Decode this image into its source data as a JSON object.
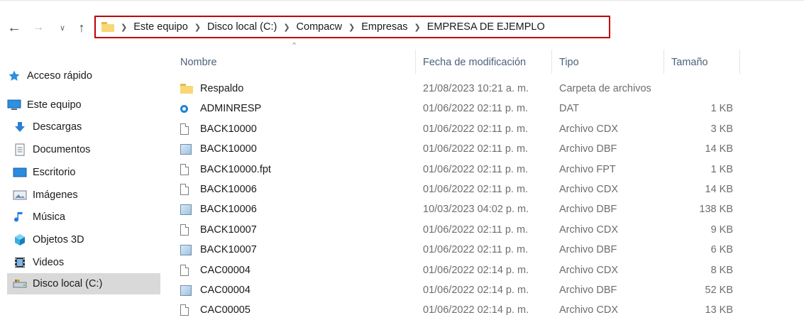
{
  "address": {
    "crumbs": [
      "Este equipo",
      "Disco local (C:)",
      "Compacw",
      "Empresas",
      "EMPRESA DE EJEMPLO"
    ]
  },
  "columns": {
    "name": "Nombre",
    "date": "Fecha de modificación",
    "type": "Tipo",
    "size": "Tamaño"
  },
  "sidebar": {
    "items": [
      {
        "label": "Acceso rápido",
        "icon": "star-icon"
      },
      {
        "label": "Este equipo",
        "icon": "computer-icon"
      },
      {
        "label": "Descargas",
        "icon": "download-icon"
      },
      {
        "label": "Documentos",
        "icon": "documents-icon"
      },
      {
        "label": "Escritorio",
        "icon": "desktop-icon"
      },
      {
        "label": "Imágenes",
        "icon": "pictures-icon"
      },
      {
        "label": "Música",
        "icon": "music-icon"
      },
      {
        "label": "Objetos 3D",
        "icon": "objects3d-icon"
      },
      {
        "label": "Videos",
        "icon": "videos-icon"
      },
      {
        "label": "Disco local (C:)",
        "icon": "drive-icon"
      }
    ]
  },
  "files": [
    {
      "name": "Respaldo",
      "date": "21/08/2023 10:21 a. m.",
      "type": "Carpeta de archivos",
      "size": "",
      "icon": "folder"
    },
    {
      "name": "ADMINRESP",
      "date": "01/06/2022 02:11 p. m.",
      "type": "DAT",
      "size": "1 KB",
      "icon": "dat"
    },
    {
      "name": "BACK10000",
      "date": "01/06/2022 02:11 p. m.",
      "type": "Archivo CDX",
      "size": "3 KB",
      "icon": "doc"
    },
    {
      "name": "BACK10000",
      "date": "01/06/2022 02:11 p. m.",
      "type": "Archivo DBF",
      "size": "14 KB",
      "icon": "dbf"
    },
    {
      "name": "BACK10000.fpt",
      "date": "01/06/2022 02:11 p. m.",
      "type": "Archivo FPT",
      "size": "1 KB",
      "icon": "doc"
    },
    {
      "name": "BACK10006",
      "date": "01/06/2022 02:11 p. m.",
      "type": "Archivo CDX",
      "size": "14 KB",
      "icon": "doc"
    },
    {
      "name": "BACK10006",
      "date": "10/03/2023 04:02 p. m.",
      "type": "Archivo DBF",
      "size": "138 KB",
      "icon": "dbf"
    },
    {
      "name": "BACK10007",
      "date": "01/06/2022 02:11 p. m.",
      "type": "Archivo CDX",
      "size": "9 KB",
      "icon": "doc"
    },
    {
      "name": "BACK10007",
      "date": "01/06/2022 02:11 p. m.",
      "type": "Archivo DBF",
      "size": "6 KB",
      "icon": "dbf"
    },
    {
      "name": "CAC00004",
      "date": "01/06/2022 02:14 p. m.",
      "type": "Archivo CDX",
      "size": "8 KB",
      "icon": "doc"
    },
    {
      "name": "CAC00004",
      "date": "01/06/2022 02:14 p. m.",
      "type": "Archivo DBF",
      "size": "52 KB",
      "icon": "dbf"
    },
    {
      "name": "CAC00005",
      "date": "01/06/2022 02:14 p. m.",
      "type": "Archivo CDX",
      "size": "13 KB",
      "icon": "doc"
    }
  ]
}
